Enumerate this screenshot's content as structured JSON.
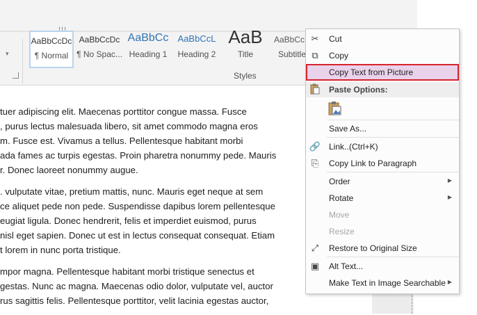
{
  "ribbon": {
    "styles": [
      {
        "preview": "AaBbCcDc",
        "caption": "¶ Normal",
        "selected": true
      },
      {
        "preview": "AaBbCcDc",
        "caption": "¶ No Spac..."
      },
      {
        "preview": "AaBbCc",
        "caption": "Heading 1"
      },
      {
        "preview": "AaBbCcL",
        "caption": "Heading 2"
      },
      {
        "preview": "AaB",
        "caption": "Title"
      },
      {
        "preview": "AaBbCcE",
        "caption": "Subtitle"
      }
    ],
    "group_label": "Styles",
    "colors": {
      "heading_preview": "#2e74b5",
      "title_preview": "#333333"
    }
  },
  "document": {
    "paragraphs": [
      [
        "tuer adipiscing elit. Maecenas porttitor congue massa. Fusce",
        ", purus lectus malesuada libero, sit amet commodo magna eros",
        "m. Fusce est. Vivamus a tellus. Pellentesque habitant morbi",
        "ada fames ac turpis egestas. Proin pharetra nonummy pede. Mauris",
        "r. Donec laoreet nonummy augue."
      ],
      [
        ". vulputate vitae, pretium mattis, nunc. Mauris eget neque at sem",
        "ce aliquet pede non pede. Suspendisse dapibus lorem pellentesque",
        "eugiat ligula. Donec hendrerit, felis et imperdiet euismod, purus",
        "nisl eget sapien. Donec ut est in lectus consequat consequat. Etiam",
        "t lorem in nunc porta tristique."
      ],
      [
        "mpor magna. Pellentesque habitant morbi tristique senectus et",
        "gestas. Nunc ac magna. Maecenas odio dolor, vulputate vel, auctor",
        "rus sagittis felis. Pellentesque porttitor, velit lacinia egestas auctor,"
      ]
    ]
  },
  "context_menu": {
    "cut": "Cut",
    "copy": "Copy",
    "copy_text_from_picture": "Copy Text from Picture",
    "paste_options": "Paste Options:",
    "save_as": "Save As...",
    "link": "Link...",
    "link_shortcut": "(Ctrl+K)",
    "copy_link_to_paragraph": "Copy Link to Paragraph",
    "order": "Order",
    "rotate": "Rotate",
    "move": "Move",
    "resize": "Resize",
    "restore_to_original_size": "Restore to Original Size",
    "alt_text": "Alt Text...",
    "make_text_searchable": "Make Text in Image Searchable",
    "highlight_color": "#e9d2ea",
    "highlight_border": "#d6232c"
  }
}
